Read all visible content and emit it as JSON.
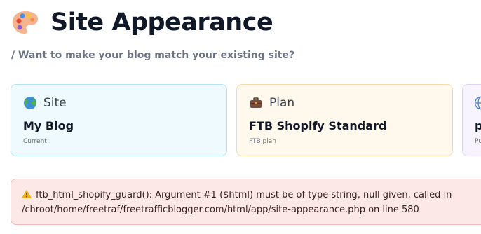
{
  "header": {
    "icon": "artist-palette-icon",
    "title": "Site Appearance",
    "subtitle": "/ Want to make your blog match your existing site?"
  },
  "cards": [
    {
      "icon": "globe-icon",
      "label": "Site",
      "value": "My Blog",
      "caption": "Current",
      "color": "#effaff"
    },
    {
      "icon": "briefcase-icon",
      "label": "Plan",
      "value": "FTB Shopify Standard",
      "caption": "FTB plan",
      "color": "#fff8ec"
    },
    {
      "icon": "globe-icon",
      "label": "",
      "value": "p",
      "caption": "Pu",
      "color": "#f7f4ff"
    }
  ],
  "alert": {
    "icon": "warning-icon",
    "line1": "ftb_html_shopify_guard(): Argument #1 ($html) must be of type string, null given, called in",
    "line2": "/chroot/home/freetraf/freetrafficblogger.com/html/app/site-appearance.php on line 580",
    "color": "#fde8e8"
  }
}
